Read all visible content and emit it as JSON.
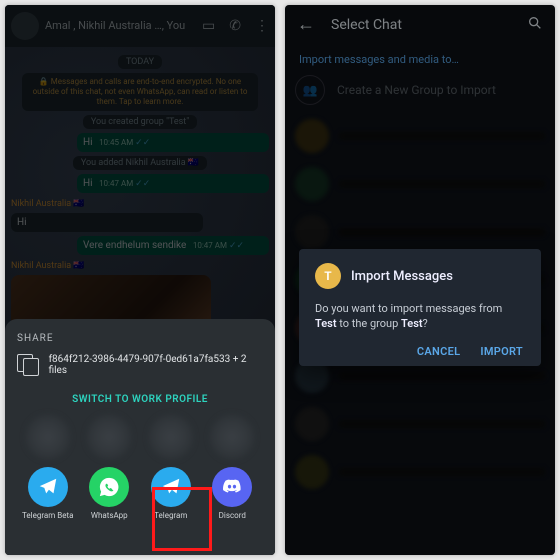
{
  "left": {
    "header": {
      "title": "Amal , Nikhil Australia …, You"
    },
    "pills": {
      "today": "TODAY"
    },
    "encryption": "🔒 Messages and calls are end-to-end encrypted. No one outside of this chat, not even WhatsApp, can read or listen to them. Tap to learn more.",
    "sys1": "You created group \"Test\"",
    "sys2": "You added Nikhil Australia 🇦🇺",
    "m1": {
      "text": "Hi",
      "time": "10:45 AM"
    },
    "m2": {
      "text": "Hi",
      "time": "10:47 AM"
    },
    "senderA": "Nikhil Australia 🇦🇺",
    "m3": {
      "text": "Hi"
    },
    "m4": {
      "text": "Vere endhelum sendike",
      "time": "10:47 AM"
    },
    "senderB": "Nikhil Australia 🇦🇺",
    "share": {
      "label": "SHARE",
      "filename": "f864f212-3986-4479-907f-0ed61a7fa533 + 2 files",
      "work": "SWITCH TO WORK PROFILE",
      "apps": {
        "tg_beta": "Telegram Beta",
        "whatsapp": "WhatsApp",
        "telegram": "Telegram",
        "discord": "Discord"
      }
    }
  },
  "right": {
    "header": {
      "title": "Select Chat"
    },
    "import_header": "Import messages and media to…",
    "new_group": "Create a New Group to Import",
    "dialog": {
      "avatar_letter": "T",
      "title": "Import Messages",
      "body_a": "Do you want to import messages from ",
      "body_from": "Test",
      "body_b": " to the group ",
      "body_to": "Test",
      "body_c": "?",
      "cancel": "CANCEL",
      "import": "IMPORT"
    }
  }
}
